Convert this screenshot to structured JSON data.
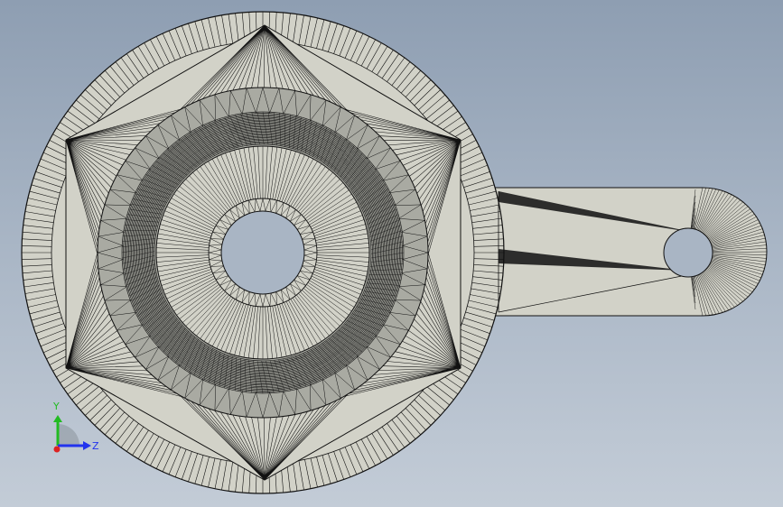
{
  "colors": {
    "part_face": "#d2d2c8",
    "mesh_line": "#111111",
    "fillet_band": "#a9aaa2",
    "axis_y": "#22bb22",
    "axis_z": "#2233ee",
    "axis_x": "#dd2222"
  },
  "triad": {
    "y_label": "Y",
    "z_label": "Z"
  },
  "icons": {
    "triad": "reference-triad-icon"
  }
}
